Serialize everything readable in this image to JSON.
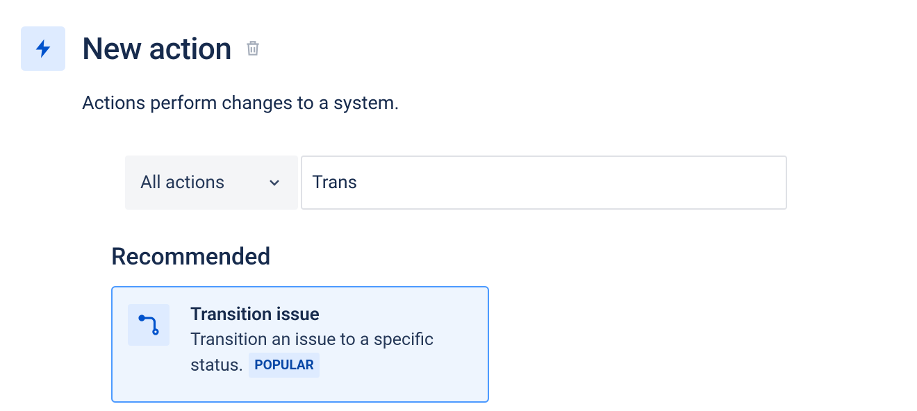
{
  "header": {
    "title": "New action",
    "description": "Actions perform changes to a system."
  },
  "controls": {
    "dropdown_label": "All actions",
    "search_value": "Trans"
  },
  "section": {
    "title": "Recommended",
    "card": {
      "title": "Transition issue",
      "desc_part1": "Transition an issue to a specific status.",
      "badge": "POPULAR"
    }
  }
}
